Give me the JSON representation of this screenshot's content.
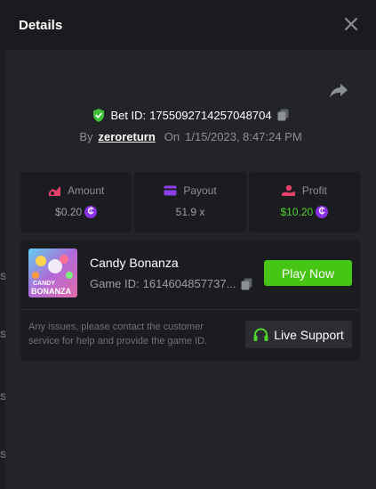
{
  "modal": {
    "title": "Details"
  },
  "bet": {
    "id_label": "Bet ID:",
    "id": "1755092714257048704",
    "by_label": "By",
    "username": "zeroreturn",
    "on_label": "On",
    "timestamp": "1/15/2023, 8:47:24 PM"
  },
  "stats": {
    "amount": {
      "label": "Amount",
      "value": "$0.20",
      "icon": "money-bag-icon",
      "color": "#e8406c"
    },
    "payout": {
      "label": "Payout",
      "value": "51.9 x",
      "icon": "wallet-icon",
      "color": "#8b3fe8"
    },
    "profit": {
      "label": "Profit",
      "value": "$10.20",
      "icon": "profit-hand-icon",
      "color": "#e8406c"
    }
  },
  "coin_symbol": "₵",
  "game": {
    "name": "Candy Bonanza",
    "thumb_text_1": "CANDY",
    "thumb_text_2": "BONANZA",
    "id_label": "Game ID:",
    "id": "1614604857737...",
    "play_label": "Play Now"
  },
  "support": {
    "text": "Any issues, please contact the customer service for help and provide the game ID.",
    "button_label": "Live Support"
  },
  "colors": {
    "accent_green": "#47c515",
    "profit_green": "#4fd32a",
    "coin_purple": "#8b2fe6",
    "modal_bg": "#232428",
    "panel_bg": "#1b1c1f"
  }
}
